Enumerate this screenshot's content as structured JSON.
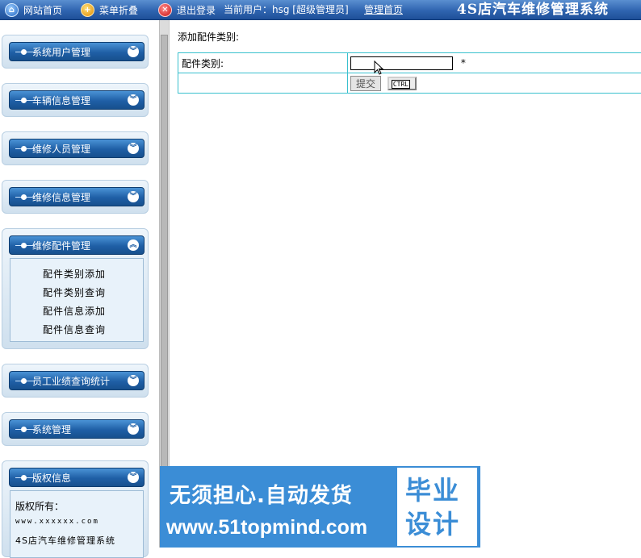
{
  "topbar": {
    "home": "网站首页",
    "fold_menu": "菜单折叠",
    "logout": "退出登录",
    "current_user": "当前用户：hsg [超级管理员]",
    "admin_home": "管理首页",
    "system_title": "4S店汽车维修管理系统"
  },
  "sidebar": {
    "groups": [
      {
        "title": "系统用户管理"
      },
      {
        "title": "车辆信息管理"
      },
      {
        "title": "维修人员管理"
      },
      {
        "title": "维修信息管理"
      },
      {
        "title": "维修配件管理",
        "items": [
          "配件类别添加",
          "配件类别查询",
          "配件信息添加",
          "配件信息查询"
        ]
      },
      {
        "title": "员工业绩查询统计"
      },
      {
        "title": "系统管理"
      },
      {
        "title": "版权信息",
        "lines": [
          "版权所有：",
          "www.xxxxxx.com",
          "4S店汽车维修管理系统"
        ]
      }
    ]
  },
  "content": {
    "heading": "添加配件类别:",
    "form": {
      "category_label": "配件类别:",
      "category_value": "",
      "required_mark": "*",
      "submit_label": "提交",
      "ctrl_label": "CTRL"
    }
  },
  "watermark": {
    "line1": "无须担心.自动发货",
    "line2": "www.51topmind.com",
    "badge1": "毕业",
    "badge2": "设计"
  }
}
